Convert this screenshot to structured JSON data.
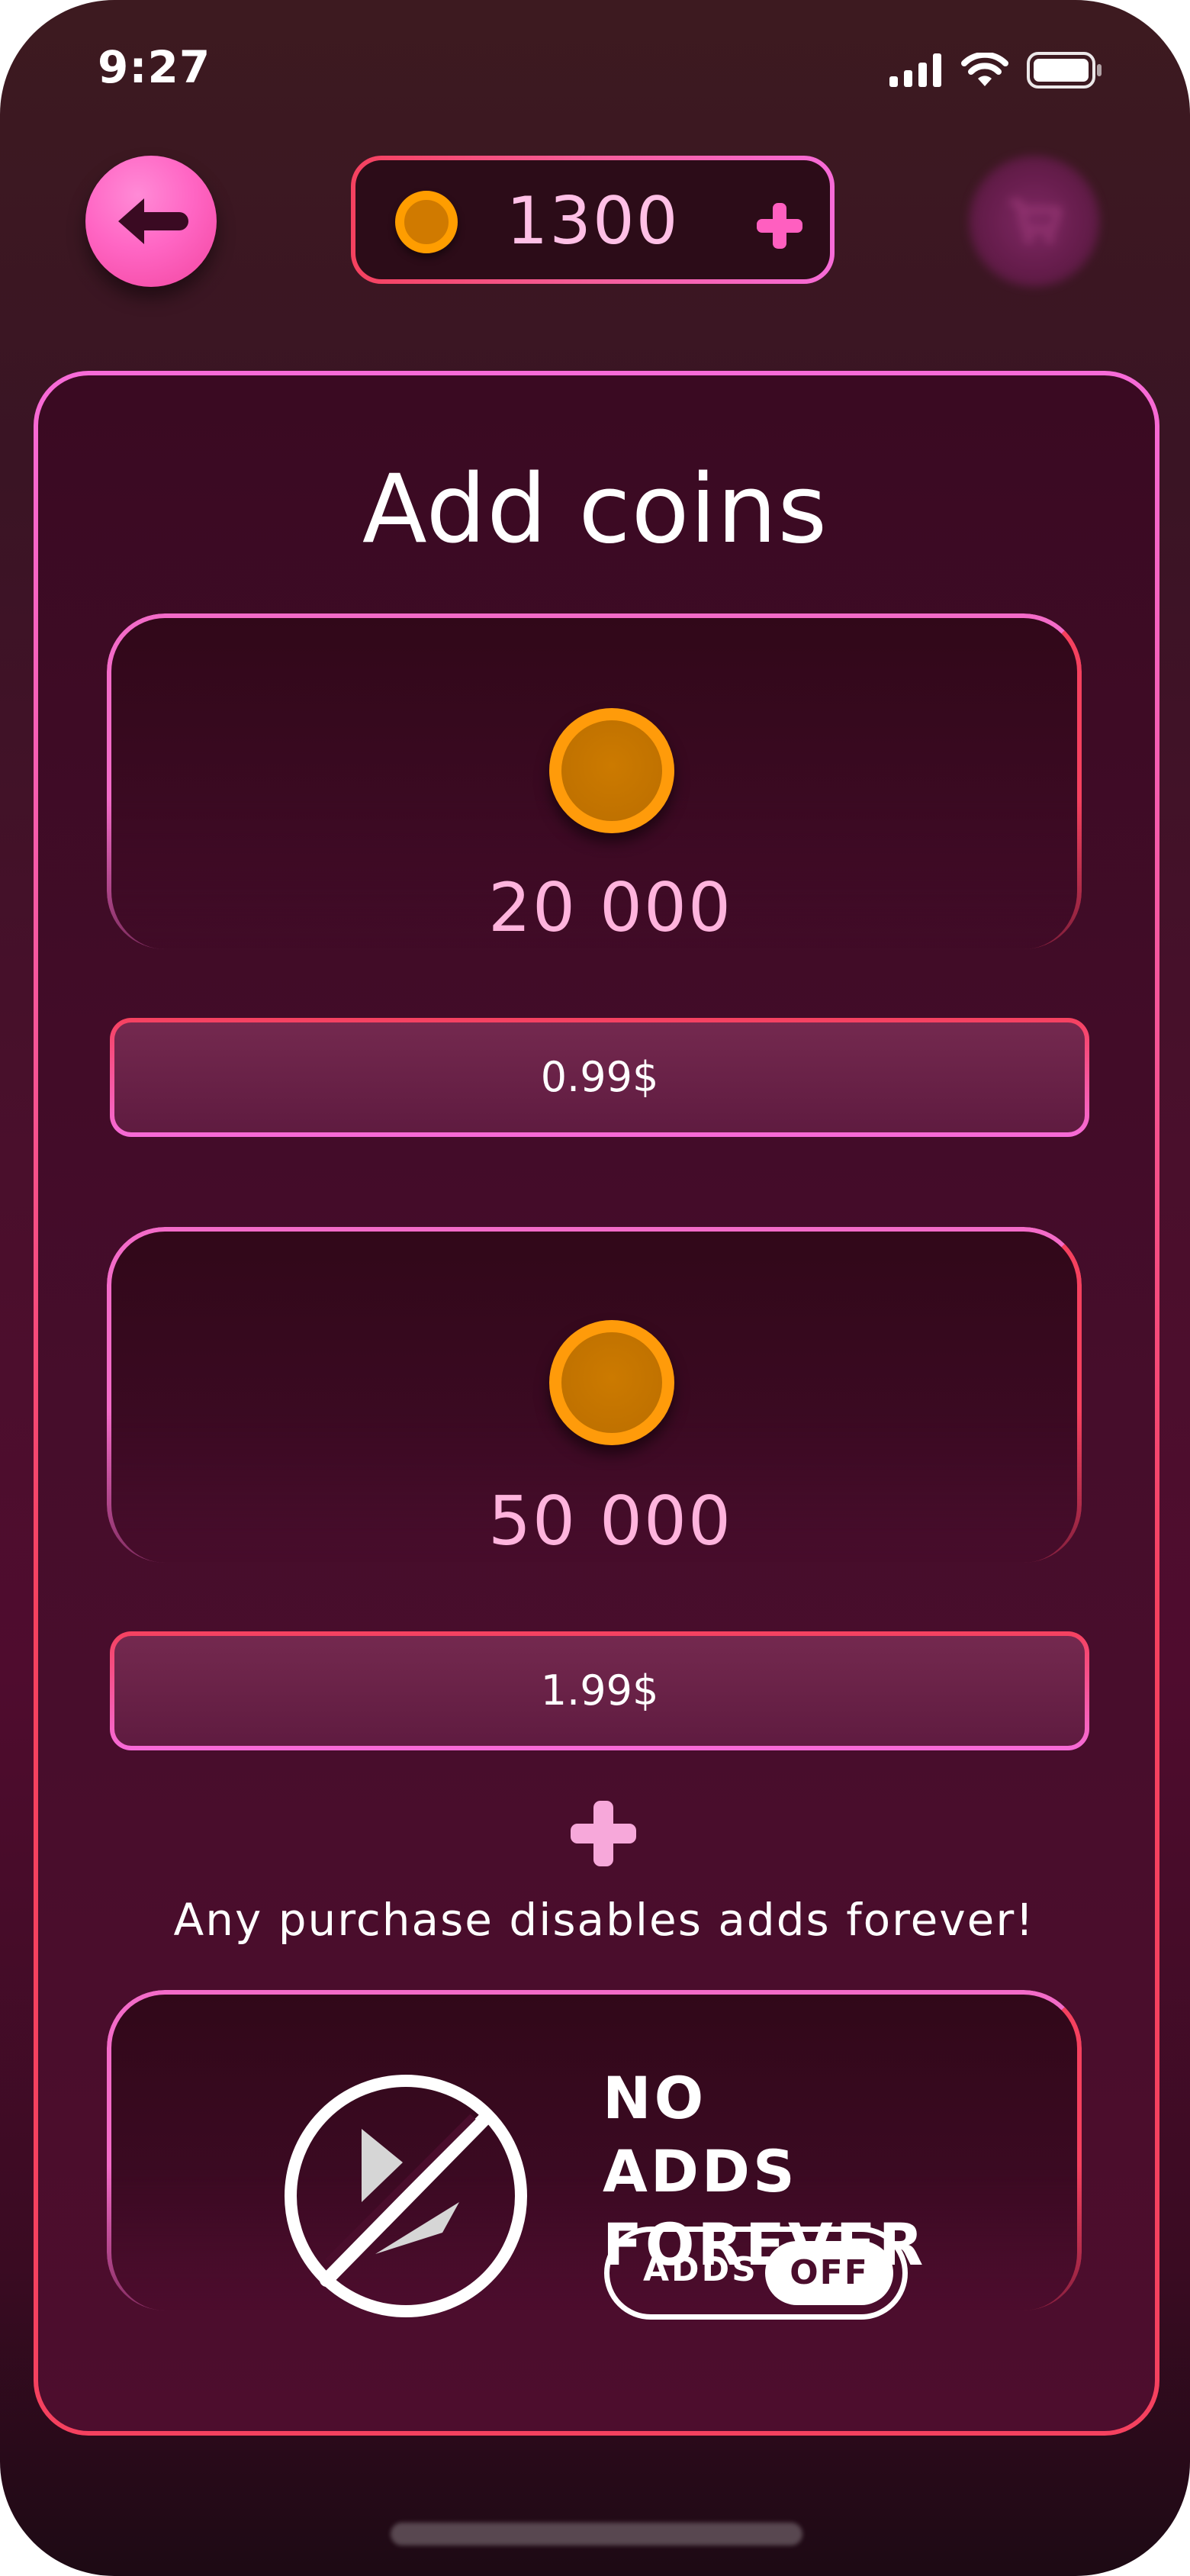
{
  "status_bar": {
    "time": "9:27",
    "icons": [
      "cellular-signal-icon",
      "wifi-icon",
      "battery-icon"
    ]
  },
  "header": {
    "back_icon": "arrow-left-icon",
    "coins_balance": "1300",
    "coin_icon": "coin-icon",
    "add_coins_icon": "plus-icon",
    "shop_icon": "cart-icon"
  },
  "panel": {
    "title": "Add coins"
  },
  "offers": [
    {
      "amount": "20 000",
      "price": "0.99$"
    },
    {
      "amount": "50 000",
      "price": "1.99$"
    }
  ],
  "notice": {
    "icon": "plus-icon",
    "text": "Any purchase disables adds forever!"
  },
  "no_ads": {
    "icon": "no-ads-icon",
    "title_line1": "NO ADDS",
    "title_line2": "FOREVER",
    "toggle_label": "ADDS",
    "toggle_state": "OFF"
  },
  "colors": {
    "accent_pink": "#ff66c4",
    "coin_orange": "#ff9b0a",
    "border_red": "#f5415f",
    "border_pink": "#f76bd8",
    "amount_text": "#ffb4dd"
  }
}
